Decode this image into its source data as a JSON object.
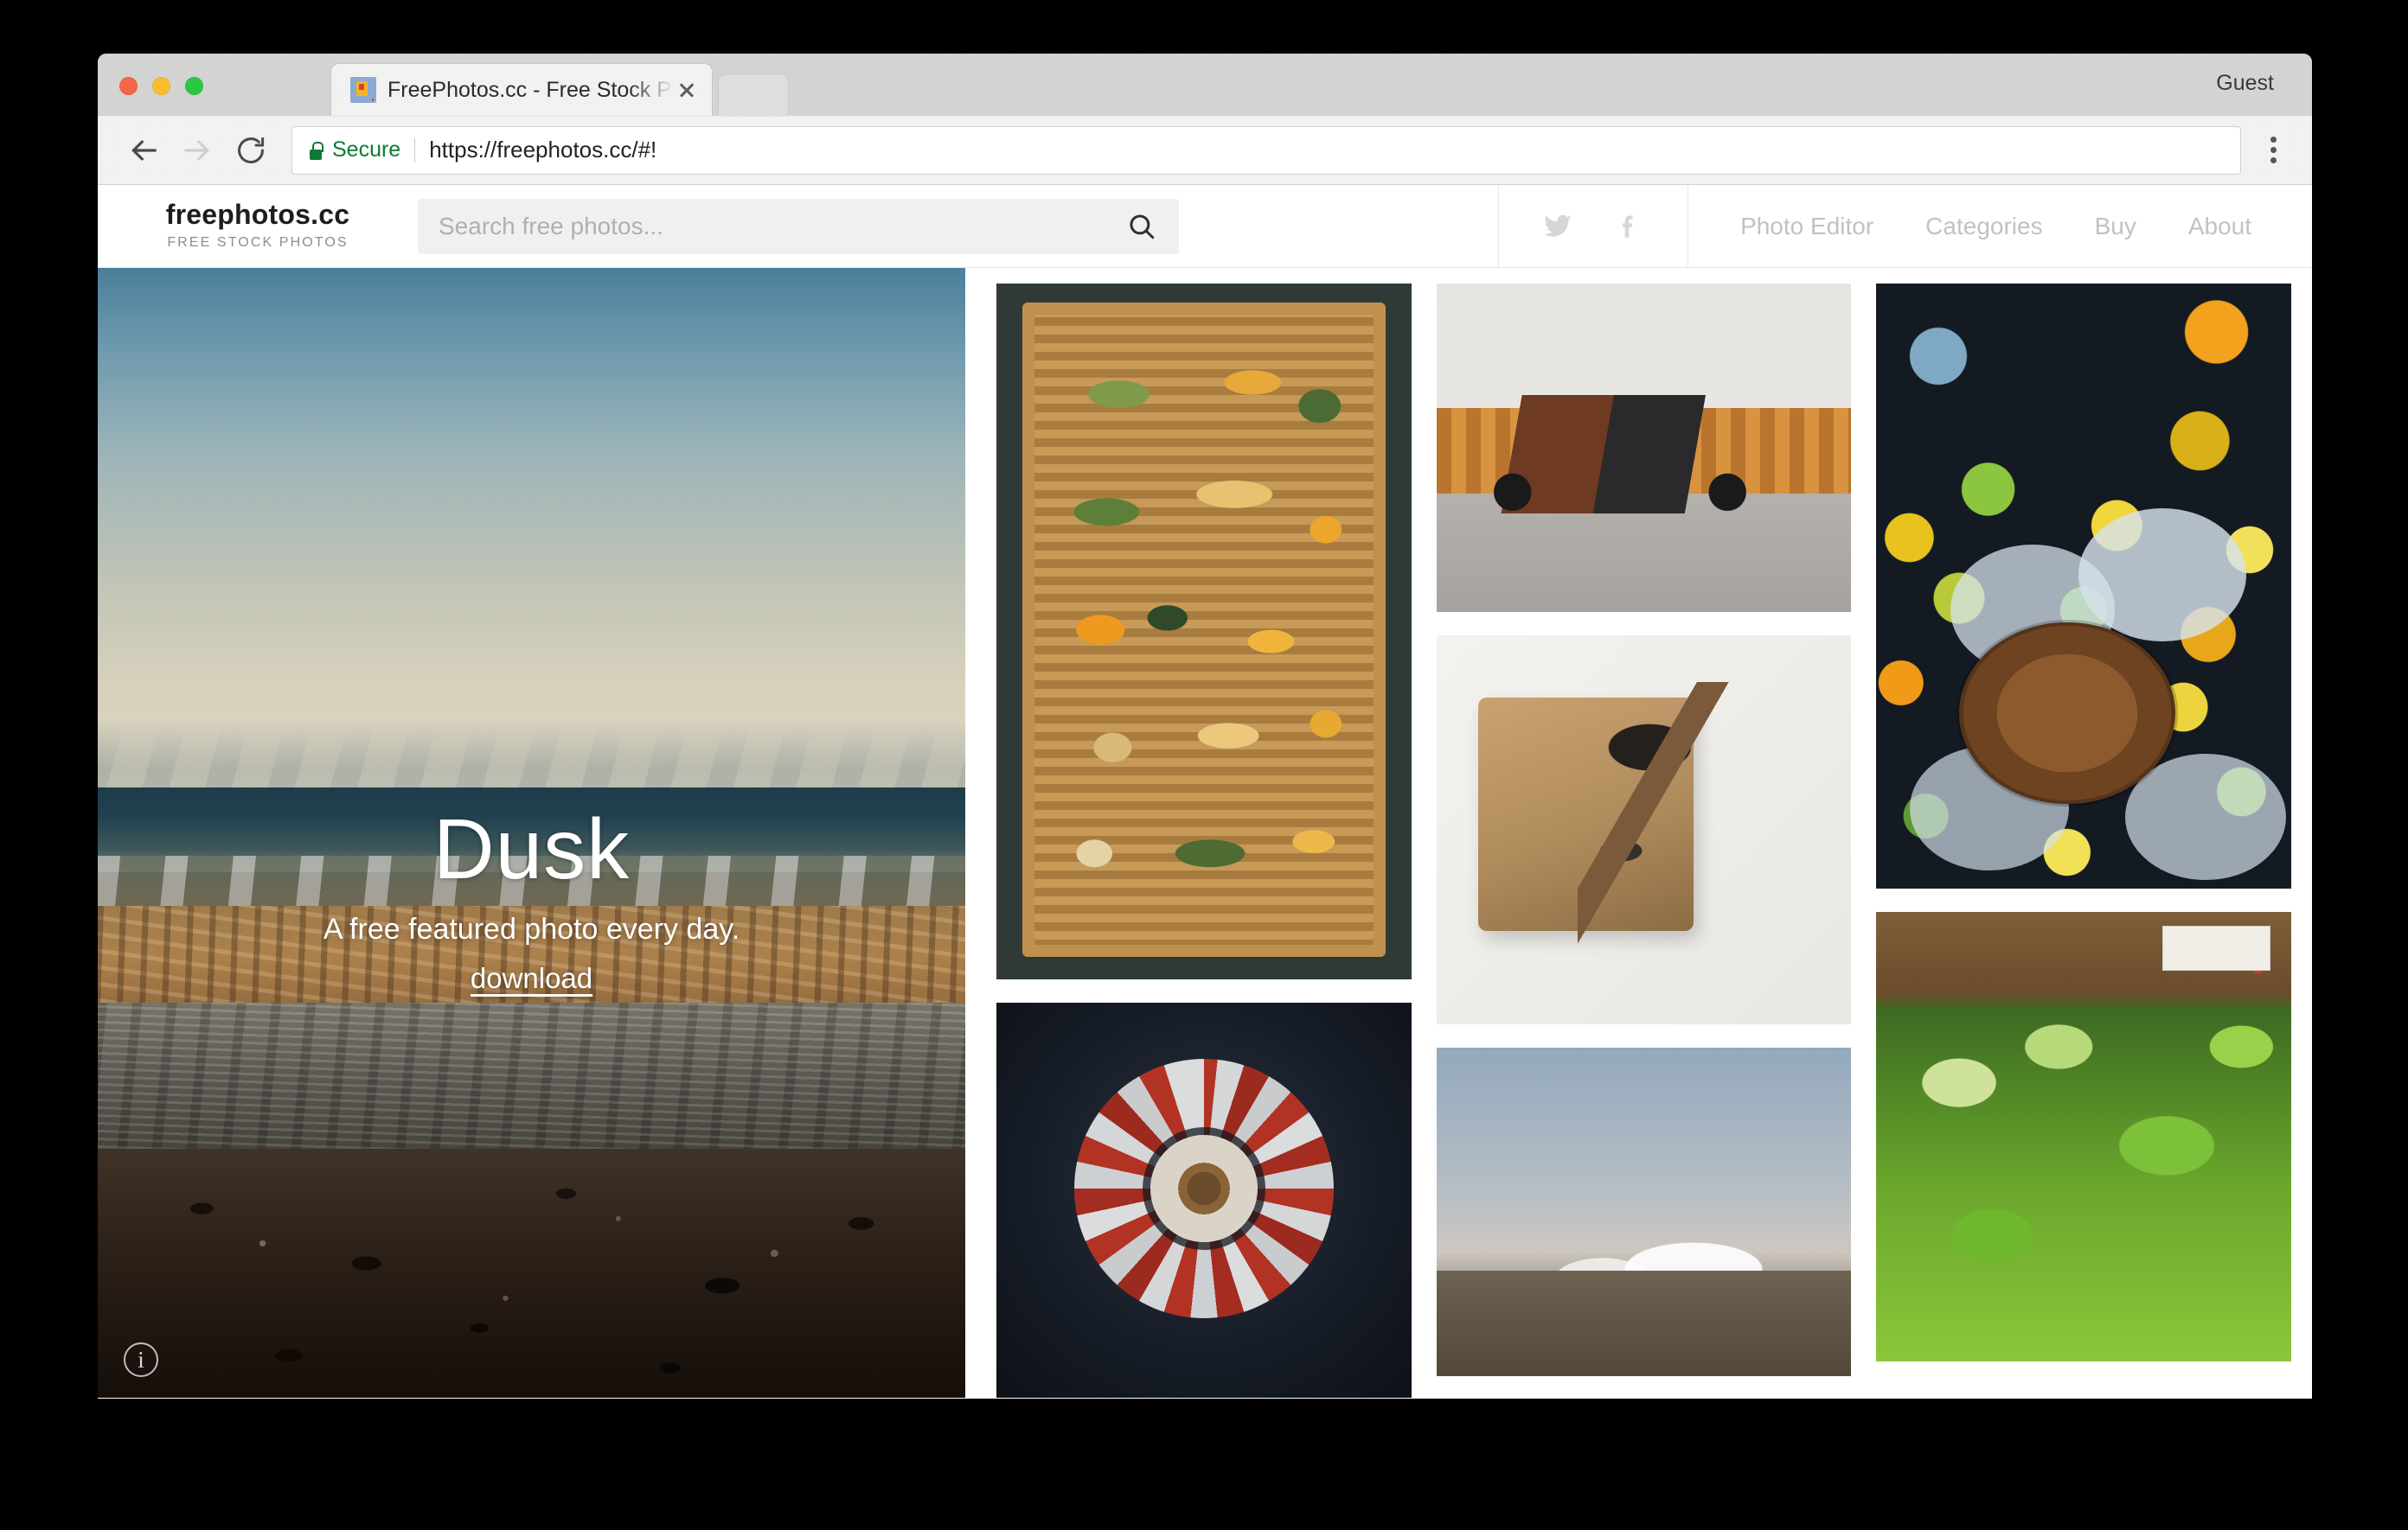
{
  "browser": {
    "profile_label": "Guest",
    "tab": {
      "title": "FreePhotos.cc - Free Stock Ph",
      "favicon_name": "freephotos-favicon"
    },
    "toolbar": {
      "back_icon": "back-arrow-icon",
      "forward_icon": "forward-arrow-icon",
      "reload_icon": "reload-icon",
      "security_label": "Secure",
      "url": "https://freephotos.cc/#!",
      "menu_icon": "three-dot-menu-icon"
    },
    "traffic_lights": {
      "close_color": "#f5654a",
      "minimize_color": "#fbbd2e",
      "maximize_color": "#2ac840"
    }
  },
  "site": {
    "brand": {
      "name": "freephotos.cc",
      "tagline": "FREE STOCK PHOTOS"
    },
    "search": {
      "placeholder": "Search free photos...",
      "value": "",
      "icon": "search-icon"
    },
    "social": [
      {
        "name": "twitter-icon",
        "label": "Twitter"
      },
      {
        "name": "facebook-icon",
        "label": "Facebook"
      }
    ],
    "nav": [
      {
        "label": "Photo Editor"
      },
      {
        "label": "Categories"
      },
      {
        "label": "Buy"
      },
      {
        "label": "About"
      }
    ],
    "hero": {
      "title": "Dusk",
      "subtitle": "A free featured photo every day.",
      "download_label": "download",
      "info_glyph": "i",
      "alt": "Dusk beach with dark rocks, shallow water and distant mountains"
    },
    "grid": {
      "columns": [
        {
          "photos": [
            {
              "alt": "Wicker basket of assorted squash and gourds",
              "style": "p-squash"
            },
            {
              "alt": "Red and chrome valve handwheel marked SHUT",
              "style": "p-valve"
            }
          ]
        },
        {
          "photos": [
            {
              "alt": "Motorcycle parked by a wooden fence",
              "style": "p-moto"
            },
            {
              "alt": "Leather satchel with sunglasses and wallet",
              "style": "p-bag"
            },
            {
              "alt": "Geothermal landscape with steam and mountains",
              "style": "p-land"
            }
          ]
        },
        {
          "photos": [
            {
              "alt": "Citrus slices with ice cubes and bowl of brown sugar",
              "style": "p-citrus"
            },
            {
              "alt": "Fresh lettuce at a market stall",
              "style": "p-greens"
            }
          ]
        }
      ]
    }
  },
  "colors": {
    "brand_text": "#1d1d1d",
    "nav_text": "#c2c2c2",
    "secure_green": "#0c7a33",
    "search_bg": "#f0f0f0",
    "page_bg": "#ffffff",
    "desktop_bg": "#000000"
  }
}
